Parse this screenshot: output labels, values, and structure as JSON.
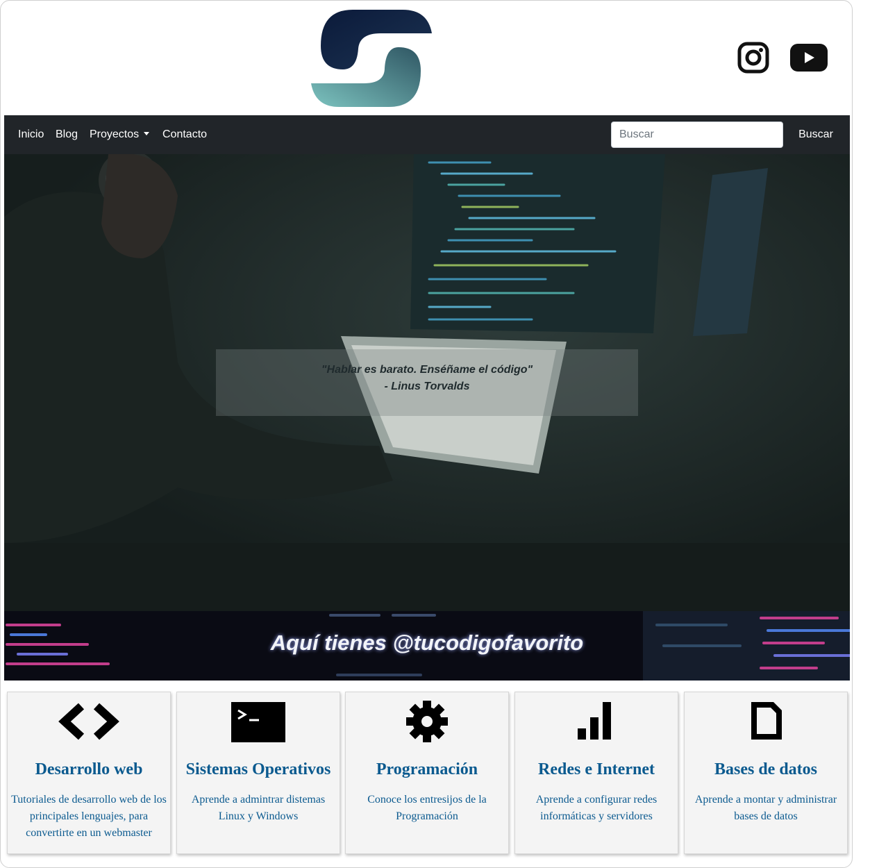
{
  "header": {
    "logo": "S-logo",
    "social": [
      {
        "icon": "instagram-icon"
      },
      {
        "icon": "youtube-icon"
      }
    ]
  },
  "nav": {
    "links": [
      "Inicio",
      "Blog",
      "Proyectos",
      "Contacto"
    ],
    "search_placeholder": "Buscar",
    "search_button": "Buscar",
    "bg_color": "#212529"
  },
  "hero": {
    "quote": "\"Hablar es barato. Enséñame el código\"",
    "author": "- Linus Torvalds"
  },
  "banner": {
    "title": "Aquí tienes @tucodigofavorito"
  },
  "cards": [
    {
      "icon": "code-brackets-icon",
      "title": "Desarrollo web",
      "desc": "Tutoriales de desarrollo web de los principales lenguajes, para convertirte en un webmaster"
    },
    {
      "icon": "terminal-icon",
      "title": "Sistemas Operativos",
      "desc": "Aprende a admintrar distemas Linux y Windows"
    },
    {
      "icon": "gear-icon",
      "title": "Programación",
      "desc": "Conoce los entresijos de la Programación"
    },
    {
      "icon": "signal-bars-icon",
      "title": "Redes e Internet",
      "desc": "Aprende a configurar redes informáticas y servidores"
    },
    {
      "icon": "document-icon",
      "title": "Bases de datos",
      "desc": "Aprende a montar y administrar bases de datos"
    }
  ],
  "colors": {
    "card_text": "#0b5a8f",
    "logo_dark": "#0f1e3d",
    "logo_teal": "#6fb8b4"
  }
}
